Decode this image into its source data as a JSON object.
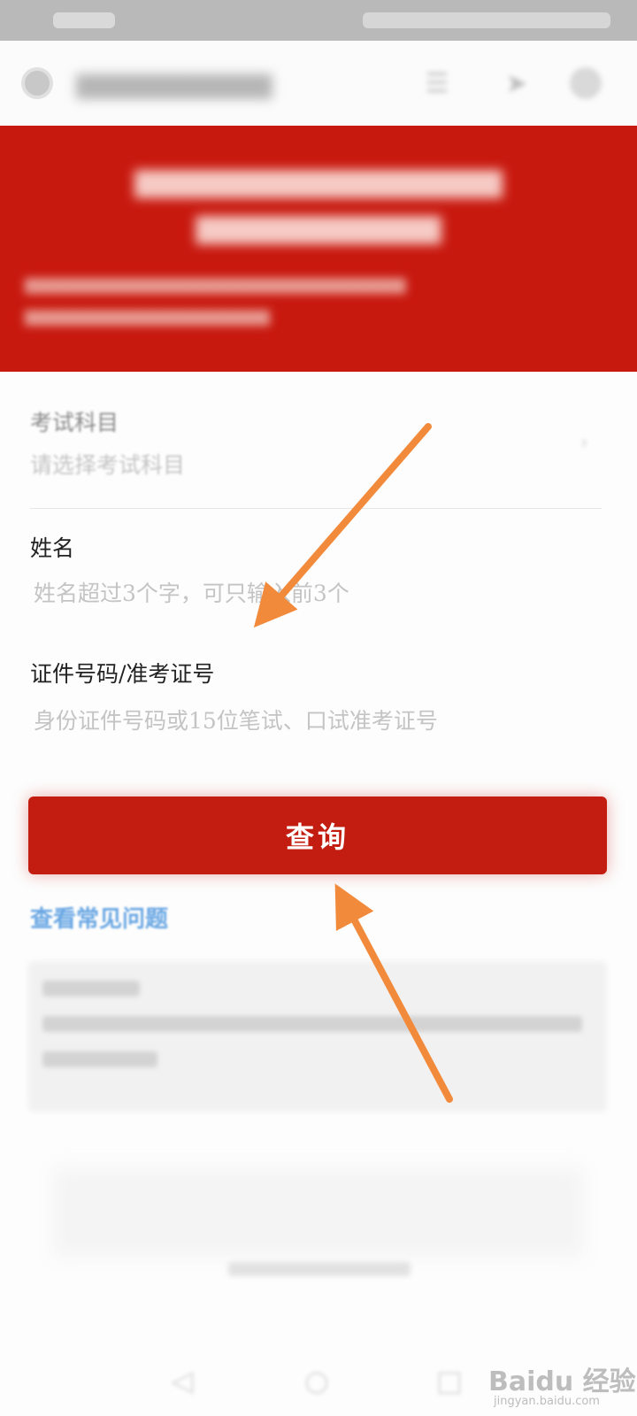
{
  "form": {
    "subject": {
      "label": "考试科目",
      "placeholder": "请选择考试科目"
    },
    "name": {
      "label": "姓名",
      "placeholder": "姓名超过3个字，可只输入前3个"
    },
    "id": {
      "label": "证件号码/准考证号",
      "placeholder": "身份证件号码或15位笔试、口试准考证号"
    }
  },
  "query_button": "查询",
  "faq_link": "查看常见问题",
  "watermark": {
    "text": "Baidu 经验",
    "url": "jingyan.baidu.com"
  },
  "colors": {
    "banner": "#c8190f",
    "button": "#c21d10",
    "link": "#6aa7e3",
    "arrow": "#f28a3c"
  }
}
